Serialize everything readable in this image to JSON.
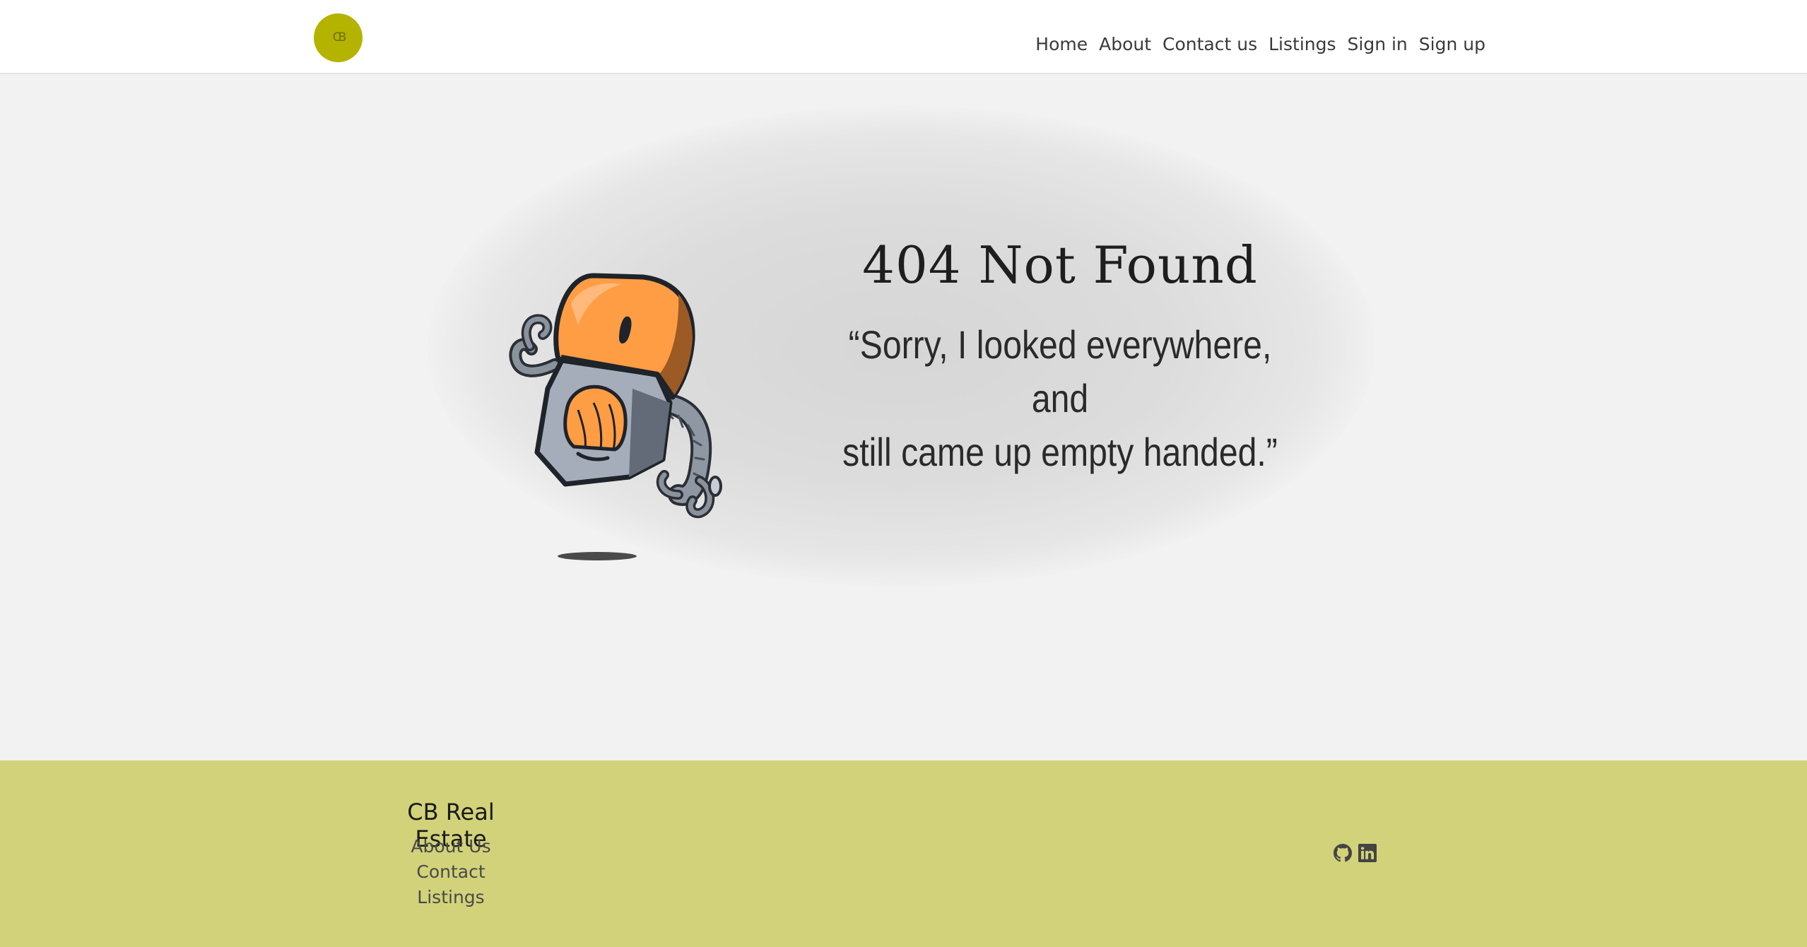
{
  "header": {
    "logo": {
      "text": "CB",
      "color": "#b3b300"
    },
    "nav": [
      {
        "label": "Home"
      },
      {
        "label": "About"
      },
      {
        "label": "Contact us"
      },
      {
        "label": "Listings"
      },
      {
        "label": "Sign in"
      },
      {
        "label": "Sign up"
      }
    ]
  },
  "main": {
    "error_title": "404 Not Found",
    "error_message_line1": "“Sorry, I looked everywhere, and",
    "error_message_line2": "still came up empty handed.”",
    "illustration": "robot-illustration"
  },
  "footer": {
    "brand": "CB Real Estate",
    "links": [
      {
        "label": "About Us"
      },
      {
        "label": "Contact"
      },
      {
        "label": "Listings"
      }
    ],
    "social": [
      {
        "icon": "github-icon"
      },
      {
        "icon": "linkedin-icon"
      }
    ],
    "background_color": "#d2d27a"
  }
}
